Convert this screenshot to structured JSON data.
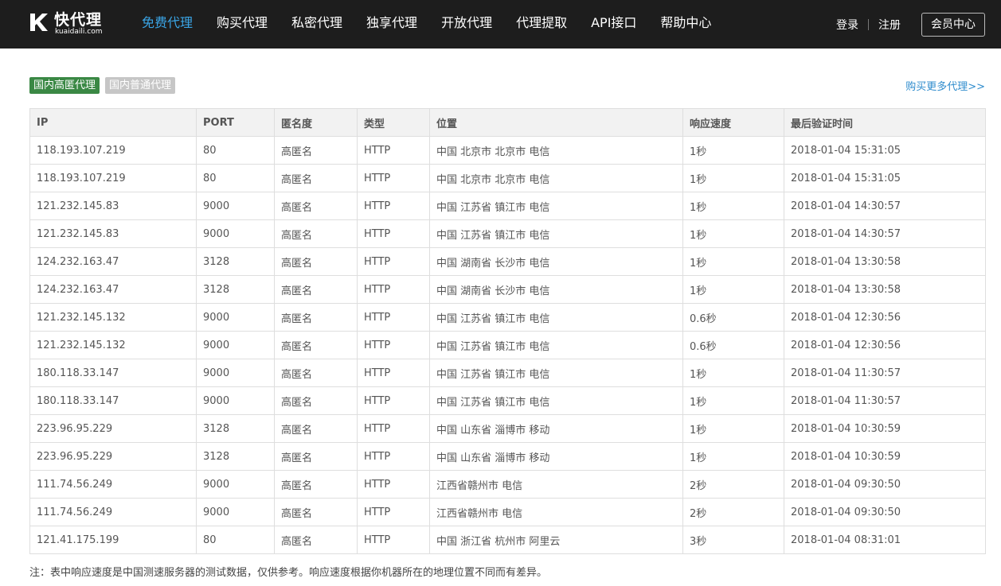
{
  "logo": {
    "name": "快代理",
    "domain": "kuaidaili.com"
  },
  "nav": [
    {
      "label": "免费代理",
      "active": true
    },
    {
      "label": "购买代理"
    },
    {
      "label": "私密代理"
    },
    {
      "label": "独享代理"
    },
    {
      "label": "开放代理"
    },
    {
      "label": "代理提取"
    },
    {
      "label": "API接口"
    },
    {
      "label": "帮助中心"
    }
  ],
  "user": {
    "login": "登录",
    "register": "注册",
    "member_center": "会员中心"
  },
  "tabs": {
    "high_anon": "国内高匿代理",
    "normal": "国内普通代理"
  },
  "more_link": "购买更多代理>>",
  "table": {
    "headers": [
      "IP",
      "PORT",
      "匿名度",
      "类型",
      "位置",
      "响应速度",
      "最后验证时间"
    ],
    "rows": [
      [
        "118.193.107.219",
        "80",
        "高匿名",
        "HTTP",
        "中国 北京市 北京市 电信",
        "1秒",
        "2018-01-04 15:31:05"
      ],
      [
        "118.193.107.219",
        "80",
        "高匿名",
        "HTTP",
        "中国 北京市 北京市 电信",
        "1秒",
        "2018-01-04 15:31:05"
      ],
      [
        "121.232.145.83",
        "9000",
        "高匿名",
        "HTTP",
        "中国 江苏省 镇江市 电信",
        "1秒",
        "2018-01-04 14:30:57"
      ],
      [
        "121.232.145.83",
        "9000",
        "高匿名",
        "HTTP",
        "中国 江苏省 镇江市 电信",
        "1秒",
        "2018-01-04 14:30:57"
      ],
      [
        "124.232.163.47",
        "3128",
        "高匿名",
        "HTTP",
        "中国 湖南省 长沙市 电信",
        "1秒",
        "2018-01-04 13:30:58"
      ],
      [
        "124.232.163.47",
        "3128",
        "高匿名",
        "HTTP",
        "中国 湖南省 长沙市 电信",
        "1秒",
        "2018-01-04 13:30:58"
      ],
      [
        "121.232.145.132",
        "9000",
        "高匿名",
        "HTTP",
        "中国 江苏省 镇江市 电信",
        "0.6秒",
        "2018-01-04 12:30:56"
      ],
      [
        "121.232.145.132",
        "9000",
        "高匿名",
        "HTTP",
        "中国 江苏省 镇江市 电信",
        "0.6秒",
        "2018-01-04 12:30:56"
      ],
      [
        "180.118.33.147",
        "9000",
        "高匿名",
        "HTTP",
        "中国 江苏省 镇江市 电信",
        "1秒",
        "2018-01-04 11:30:57"
      ],
      [
        "180.118.33.147",
        "9000",
        "高匿名",
        "HTTP",
        "中国 江苏省 镇江市 电信",
        "1秒",
        "2018-01-04 11:30:57"
      ],
      [
        "223.96.95.229",
        "3128",
        "高匿名",
        "HTTP",
        "中国 山东省 淄博市 移动",
        "1秒",
        "2018-01-04 10:30:59"
      ],
      [
        "223.96.95.229",
        "3128",
        "高匿名",
        "HTTP",
        "中国 山东省 淄博市 移动",
        "1秒",
        "2018-01-04 10:30:59"
      ],
      [
        "111.74.56.249",
        "9000",
        "高匿名",
        "HTTP",
        "江西省赣州市 电信",
        "2秒",
        "2018-01-04 09:30:50"
      ],
      [
        "111.74.56.249",
        "9000",
        "高匿名",
        "HTTP",
        "江西省赣州市 电信",
        "2秒",
        "2018-01-04 09:30:50"
      ],
      [
        "121.41.175.199",
        "80",
        "高匿名",
        "HTTP",
        "中国 浙江省 杭州市 阿里云",
        "3秒",
        "2018-01-04 08:31:01"
      ]
    ]
  },
  "note": "注：表中响应速度是中国测速服务器的测试数据，仅供参考。响应速度根据你机器所在的地理位置不同而有差异。",
  "colors": {
    "topbar": "#1d1d1d",
    "nav_active": "#3aa5e6",
    "tag_active": "#3a8844",
    "tag_inactive": "#c6c6c6",
    "link": "#2f8ccd"
  }
}
